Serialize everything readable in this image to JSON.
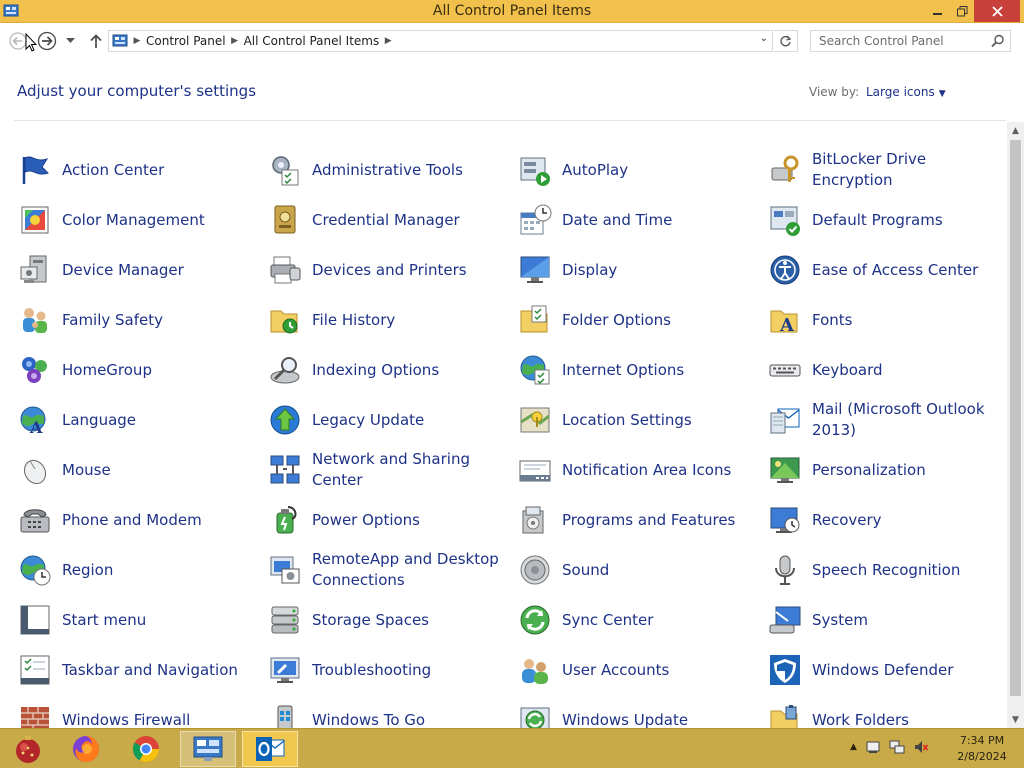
{
  "window": {
    "title": "All Control Panel Items"
  },
  "address": {
    "crumbs": [
      "Control Panel",
      "All Control Panel Items"
    ],
    "search_placeholder": "Search Control Panel"
  },
  "header": {
    "heading": "Adjust your computer's settings",
    "view_by_label": "View by:",
    "view_by_value": "Large icons"
  },
  "items": [
    {
      "label": "Action Center",
      "icon": "flag-icon"
    },
    {
      "label": "Administrative Tools",
      "icon": "admin-tools-icon"
    },
    {
      "label": "AutoPlay",
      "icon": "autoplay-icon"
    },
    {
      "label": "BitLocker Drive Encryption",
      "icon": "bitlocker-icon"
    },
    {
      "label": "Color Management",
      "icon": "color-management-icon"
    },
    {
      "label": "Credential Manager",
      "icon": "credential-icon"
    },
    {
      "label": "Date and Time",
      "icon": "clock-calendar-icon"
    },
    {
      "label": "Default Programs",
      "icon": "default-programs-icon"
    },
    {
      "label": "Device Manager",
      "icon": "device-manager-icon"
    },
    {
      "label": "Devices and Printers",
      "icon": "printer-icon"
    },
    {
      "label": "Display",
      "icon": "monitor-icon"
    },
    {
      "label": "Ease of Access Center",
      "icon": "ease-of-access-icon"
    },
    {
      "label": "Family Safety",
      "icon": "family-safety-icon"
    },
    {
      "label": "File History",
      "icon": "file-history-icon"
    },
    {
      "label": "Folder Options",
      "icon": "folder-options-icon"
    },
    {
      "label": "Fonts",
      "icon": "fonts-icon"
    },
    {
      "label": "HomeGroup",
      "icon": "homegroup-icon"
    },
    {
      "label": "Indexing Options",
      "icon": "indexing-icon"
    },
    {
      "label": "Internet Options",
      "icon": "internet-options-icon"
    },
    {
      "label": "Keyboard",
      "icon": "keyboard-icon"
    },
    {
      "label": "Language",
      "icon": "language-icon"
    },
    {
      "label": "Legacy Update",
      "icon": "legacy-update-icon"
    },
    {
      "label": "Location Settings",
      "icon": "location-icon"
    },
    {
      "label": "Mail (Microsoft Outlook 2013)",
      "icon": "mail-icon"
    },
    {
      "label": "Mouse",
      "icon": "mouse-icon"
    },
    {
      "label": "Network and Sharing Center",
      "icon": "network-icon"
    },
    {
      "label": "Notification Area Icons",
      "icon": "notification-icon"
    },
    {
      "label": "Personalization",
      "icon": "personalization-icon"
    },
    {
      "label": "Phone and Modem",
      "icon": "phone-icon"
    },
    {
      "label": "Power Options",
      "icon": "power-icon"
    },
    {
      "label": "Programs and Features",
      "icon": "programs-icon"
    },
    {
      "label": "Recovery",
      "icon": "recovery-icon"
    },
    {
      "label": "Region",
      "icon": "region-icon"
    },
    {
      "label": "RemoteApp and Desktop Connections",
      "icon": "remoteapp-icon"
    },
    {
      "label": "Sound",
      "icon": "speaker-icon"
    },
    {
      "label": "Speech Recognition",
      "icon": "microphone-icon"
    },
    {
      "label": "Start menu",
      "icon": "start-menu-icon"
    },
    {
      "label": "Storage Spaces",
      "icon": "storage-icon"
    },
    {
      "label": "Sync Center",
      "icon": "sync-icon"
    },
    {
      "label": "System",
      "icon": "system-icon"
    },
    {
      "label": "Taskbar and Navigation",
      "icon": "taskbar-icon"
    },
    {
      "label": "Troubleshooting",
      "icon": "troubleshooting-icon"
    },
    {
      "label": "User Accounts",
      "icon": "users-icon"
    },
    {
      "label": "Windows Defender",
      "icon": "shield-icon"
    },
    {
      "label": "Windows Firewall",
      "icon": "firewall-icon"
    },
    {
      "label": "Windows To Go",
      "icon": "windows-to-go-icon"
    },
    {
      "label": "Windows Update",
      "icon": "windows-update-icon"
    },
    {
      "label": "Work Folders",
      "icon": "work-folders-icon"
    }
  ],
  "taskbar": {
    "apps": [
      "start-orb-icon",
      "firefox-icon",
      "chrome-icon",
      "control-panel-icon",
      "outlook-icon"
    ],
    "time": "7:34 PM",
    "date": "2/8/2024"
  },
  "colors": {
    "titlebar": "#f2c04c",
    "taskbar": "#c8aa48",
    "link": "#1e3287",
    "close": "#c7413a"
  }
}
